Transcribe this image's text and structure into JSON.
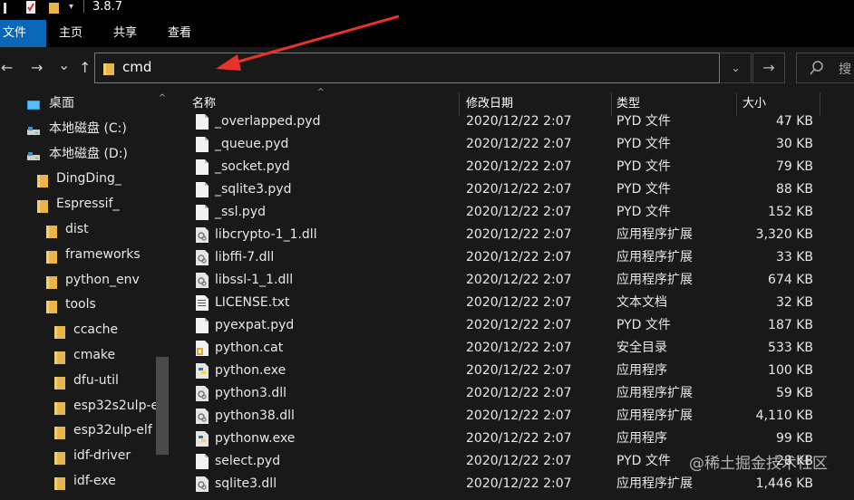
{
  "window": {
    "title": "3.8.7"
  },
  "ribbon": {
    "tabs": [
      "文件",
      "主页",
      "共享",
      "查看"
    ]
  },
  "address": {
    "value": "cmd",
    "go_symbol": "→",
    "dropdown_symbol": "⌄"
  },
  "search": {
    "placeholder": "搜"
  },
  "nav": {
    "back": "←",
    "forward": "→",
    "recent": "⌄",
    "up": "↑",
    "tree": [
      {
        "label": "桌面",
        "icon": "desktop-icon"
      },
      {
        "label": "本地磁盘 (C:)",
        "icon": "drive-icon"
      },
      {
        "label": "本地磁盘 (D:)",
        "icon": "drive-icon"
      },
      {
        "label": "DingDing_",
        "icon": "folder-icon"
      },
      {
        "label": "Espressif_",
        "icon": "folder-icon"
      },
      {
        "label": "dist",
        "icon": "folder-icon"
      },
      {
        "label": "frameworks",
        "icon": "folder-icon"
      },
      {
        "label": "python_env",
        "icon": "folder-icon"
      },
      {
        "label": "tools",
        "icon": "folder-icon"
      },
      {
        "label": "ccache",
        "icon": "folder-icon"
      },
      {
        "label": "cmake",
        "icon": "folder-icon"
      },
      {
        "label": "dfu-util",
        "icon": "folder-icon"
      },
      {
        "label": "esp32s2ulp-e",
        "icon": "folder-icon"
      },
      {
        "label": "esp32ulp-elf",
        "icon": "folder-icon"
      },
      {
        "label": "idf-driver",
        "icon": "folder-icon"
      },
      {
        "label": "idf-exe",
        "icon": "folder-icon"
      }
    ]
  },
  "columns": {
    "name": "名称",
    "date": "修改日期",
    "type": "类型",
    "size": "大小"
  },
  "files": [
    {
      "name": "_overlapped.pyd",
      "date": "2020/12/22 2:07",
      "type": "PYD 文件",
      "size": "47 KB",
      "icon": "file-icon"
    },
    {
      "name": "_queue.pyd",
      "date": "2020/12/22 2:07",
      "type": "PYD 文件",
      "size": "30 KB",
      "icon": "file-icon"
    },
    {
      "name": "_socket.pyd",
      "date": "2020/12/22 2:07",
      "type": "PYD 文件",
      "size": "79 KB",
      "icon": "file-icon"
    },
    {
      "name": "_sqlite3.pyd",
      "date": "2020/12/22 2:07",
      "type": "PYD 文件",
      "size": "88 KB",
      "icon": "file-icon"
    },
    {
      "name": "_ssl.pyd",
      "date": "2020/12/22 2:07",
      "type": "PYD 文件",
      "size": "152 KB",
      "icon": "file-icon"
    },
    {
      "name": "libcrypto-1_1.dll",
      "date": "2020/12/22 2:07",
      "type": "应用程序扩展",
      "size": "3,320 KB",
      "icon": "dll-icon"
    },
    {
      "name": "libffi-7.dll",
      "date": "2020/12/22 2:07",
      "type": "应用程序扩展",
      "size": "33 KB",
      "icon": "dll-icon"
    },
    {
      "name": "libssl-1_1.dll",
      "date": "2020/12/22 2:07",
      "type": "应用程序扩展",
      "size": "674 KB",
      "icon": "dll-icon"
    },
    {
      "name": "LICENSE.txt",
      "date": "2020/12/22 2:07",
      "type": "文本文档",
      "size": "32 KB",
      "icon": "text-file-icon"
    },
    {
      "name": "pyexpat.pyd",
      "date": "2020/12/22 2:07",
      "type": "PYD 文件",
      "size": "187 KB",
      "icon": "file-icon"
    },
    {
      "name": "python.cat",
      "date": "2020/12/22 2:07",
      "type": "安全目录",
      "size": "533 KB",
      "icon": "catalog-icon"
    },
    {
      "name": "python.exe",
      "date": "2020/12/22 2:07",
      "type": "应用程序",
      "size": "100 KB",
      "icon": "python-icon"
    },
    {
      "name": "python3.dll",
      "date": "2020/12/22 2:07",
      "type": "应用程序扩展",
      "size": "59 KB",
      "icon": "dll-icon"
    },
    {
      "name": "python38.dll",
      "date": "2020/12/22 2:07",
      "type": "应用程序扩展",
      "size": "4,110 KB",
      "icon": "dll-icon"
    },
    {
      "name": "pythonw.exe",
      "date": "2020/12/22 2:07",
      "type": "应用程序",
      "size": "99 KB",
      "icon": "python-icon"
    },
    {
      "name": "select.pyd",
      "date": "2020/12/22 2:07",
      "type": "PYD 文件",
      "size": "28 KB",
      "icon": "file-icon"
    },
    {
      "name": "sqlite3.dll",
      "date": "2020/12/22 2:07",
      "type": "应用程序扩展",
      "size": "1,446 KB",
      "icon": "dll-icon"
    }
  ],
  "watermark": "@稀土掘金技术社区",
  "colors": {
    "accent": "#0a66b7",
    "folder": "#e8b64c",
    "arrow": "#e8322c"
  }
}
